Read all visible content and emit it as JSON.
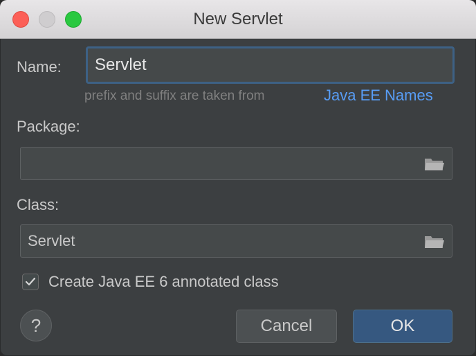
{
  "window": {
    "title": "New Servlet"
  },
  "form": {
    "name_label": "Name:",
    "name_value": "Servlet",
    "hint_text": "prefix and suffix are taken from",
    "hint_link": "Java EE Names",
    "package_label": "Package:",
    "package_value": "",
    "class_label": "Class:",
    "class_value": "Servlet",
    "checkbox_label": "Create Java EE 6 annotated class",
    "checkbox_checked": true
  },
  "buttons": {
    "help": "?",
    "cancel": "Cancel",
    "ok": "OK"
  },
  "colors": {
    "dialog_bg": "#3c3f41",
    "link": "#589df6",
    "ok_button": "#365880",
    "focus_border": "#3d6185"
  },
  "icons": {
    "browse": "folder-icon",
    "check": "checkmark-icon"
  }
}
